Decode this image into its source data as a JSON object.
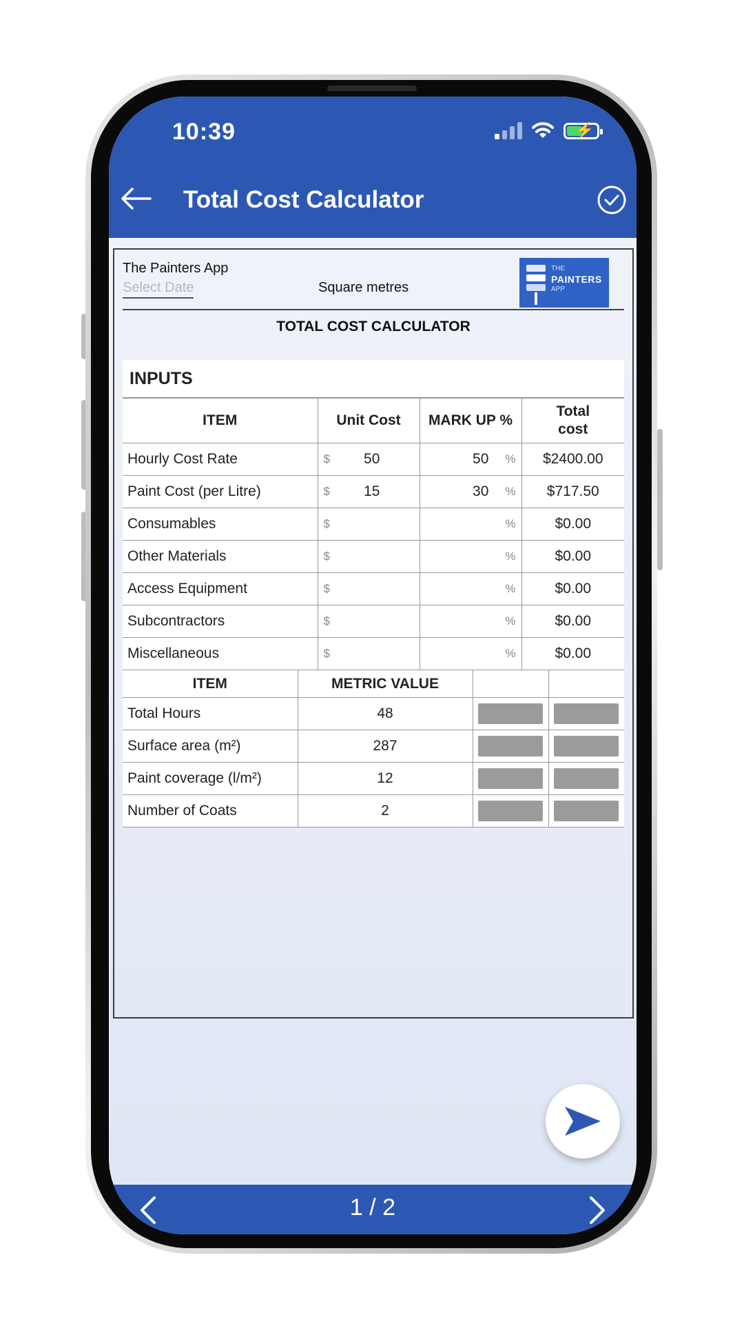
{
  "status_bar": {
    "time": "10:39"
  },
  "header": {
    "title": "Total Cost Calculator"
  },
  "sheet": {
    "company": "The Painters App",
    "date_placeholder": "Select Date",
    "units": "Square metres",
    "logo": {
      "line1": "THE",
      "line2": "PAINTERS",
      "line3": "APP"
    },
    "heading": "TOTAL COST CALCULATOR",
    "inputs_title": "INPUTS",
    "columns": [
      "ITEM",
      "Unit Cost",
      "MARK UP %",
      "Total cost"
    ],
    "currency_symbol": "$",
    "percent_symbol": "%",
    "rows": [
      {
        "item": "Hourly Cost Rate",
        "unit_cost": "50",
        "markup": "50",
        "total": "$2400.00"
      },
      {
        "item": "Paint Cost (per Litre)",
        "unit_cost": "15",
        "markup": "30",
        "total": "$717.50"
      },
      {
        "item": "Consumables",
        "unit_cost": "",
        "markup": "",
        "total": "$0.00"
      },
      {
        "item": "Other Materials",
        "unit_cost": "",
        "markup": "",
        "total": "$0.00"
      },
      {
        "item": "Access Equipment",
        "unit_cost": "",
        "markup": "",
        "total": "$0.00"
      },
      {
        "item": "Subcontractors",
        "unit_cost": "",
        "markup": "",
        "total": "$0.00"
      },
      {
        "item": "Miscellaneous",
        "unit_cost": "",
        "markup": "",
        "total": "$0.00"
      }
    ],
    "metrics_columns": [
      "ITEM",
      "METRIC VALUE"
    ],
    "metrics": [
      {
        "item": "Total Hours",
        "value": "48"
      },
      {
        "item": "Surface area (m²)",
        "value": "287"
      },
      {
        "item": "Paint coverage (l/m²)",
        "value": "12"
      },
      {
        "item": "Number of Coats",
        "value": "2"
      }
    ]
  },
  "pager": {
    "text": "1 / 2"
  },
  "colors": {
    "brand_blue": "#2c58b4",
    "fab_icon": "#2c58b4"
  }
}
